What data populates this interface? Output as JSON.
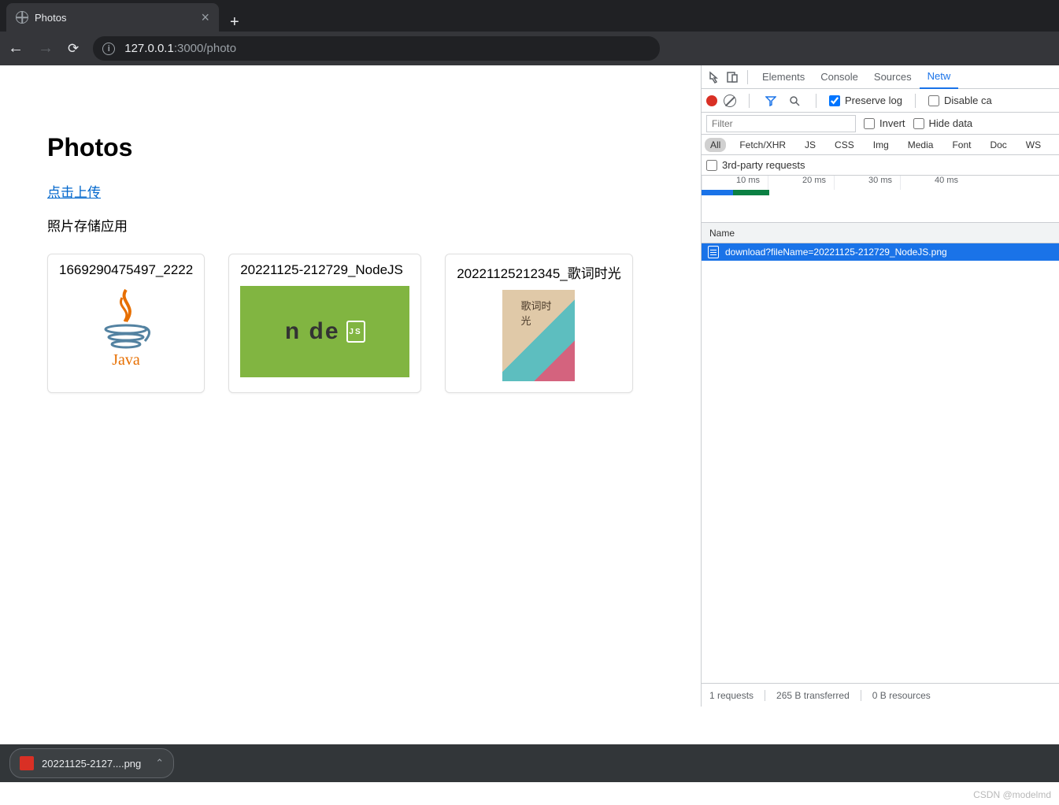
{
  "browser": {
    "tab_title": "Photos",
    "url_host": "127.0.0.1",
    "url_port": ":3000/photo"
  },
  "page": {
    "title": "Photos",
    "upload_link": "点击上传",
    "subtitle": "照片存储应用",
    "cards": [
      {
        "title": "1669290475497_2222"
      },
      {
        "title": "20221125-212729_NodeJS"
      },
      {
        "title": "20221125212345_歌词时光"
      }
    ],
    "node_label": "n   de",
    "node_js": "JS",
    "lyric_label": "歌词时光"
  },
  "devtools": {
    "tabs": {
      "elements": "Elements",
      "console": "Console",
      "sources": "Sources",
      "network": "Netw"
    },
    "preserve_log": "Preserve log",
    "disable_cache": "Disable ca",
    "filter_placeholder": "Filter",
    "invert": "Invert",
    "hide_data": "Hide data",
    "types": {
      "all": "All",
      "fetch": "Fetch/XHR",
      "js": "JS",
      "css": "CSS",
      "img": "Img",
      "media": "Media",
      "font": "Font",
      "doc": "Doc",
      "ws": "WS"
    },
    "third_party": "3rd-party requests",
    "timeline_ticks": [
      "10 ms",
      "20 ms",
      "30 ms",
      "40 ms"
    ],
    "name_header": "Name",
    "request_row": "download?fileName=20221125-212729_NodeJS.png",
    "status": {
      "requests": "1 requests",
      "transferred": "265 B transferred",
      "resources": "0 B resources"
    }
  },
  "download": {
    "filename": "20221125-2127....png"
  },
  "watermark": "CSDN @modelmd"
}
